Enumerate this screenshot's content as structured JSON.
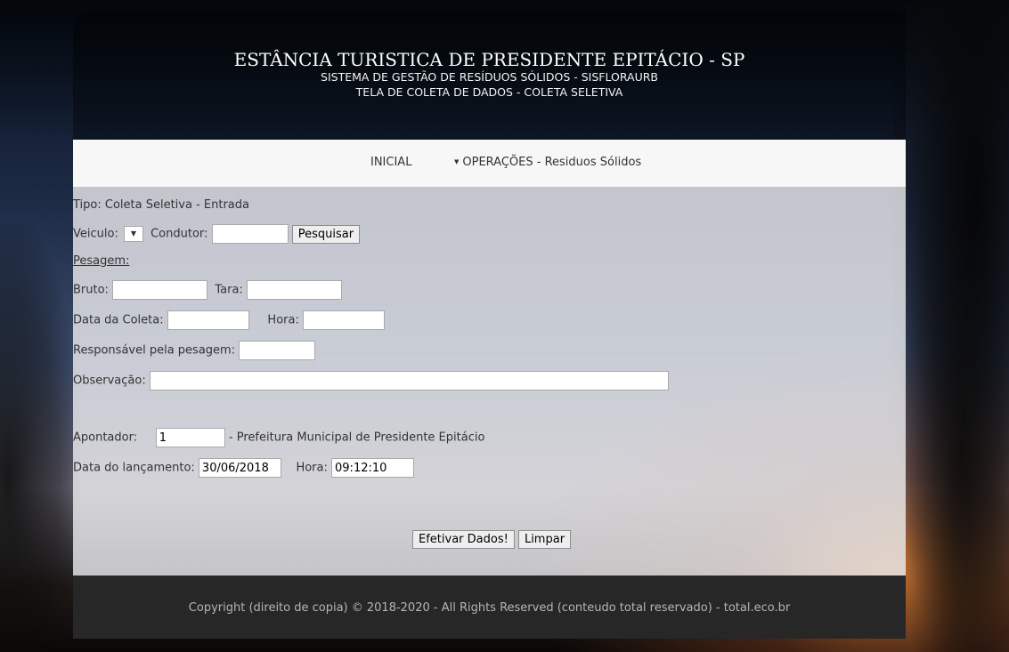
{
  "header": {
    "title": "ESTÂNCIA TURISTICA DE PRESIDENTE EPITÁCIO - SP",
    "subtitle1": "SISTEMA DE GESTÃO DE RESÍDUOS SÓLIDOS - SISFLORAURB",
    "subtitle2": "TELA DE COLETA DE DADOS - COLETA SELETIVA"
  },
  "nav": {
    "home": "INICIAL",
    "operations": "OPERAÇÕES - Residuos Sólidos"
  },
  "form": {
    "tipo": "Tipo: Coleta Seletiva - Entrada",
    "veiculo_label": "Veiculo:",
    "condutor_label": "Condutor:",
    "condutor_value": "",
    "pesquisar_label": "Pesquisar",
    "pesagem_label": "Pesagem:",
    "bruto_label": "Bruto:",
    "bruto_value": "",
    "tara_label": "Tara:",
    "tara_value": "",
    "data_coleta_label": "Data da Coleta:",
    "data_coleta_value": "",
    "hora_label": "Hora:",
    "hora_value": "",
    "responsavel_label": "Responsável pela pesagem:",
    "responsavel_value": "",
    "observacao_label": "Observação:",
    "observacao_value": "",
    "apontador_label": "Apontador:",
    "apontador_value": "1",
    "apontador_desc": "- Prefeitura Municipal de Presidente Epitácio",
    "data_lancamento_label": "Data do lançamento:",
    "data_lancamento_value": "30/06/2018",
    "hora_lancamento_label": "Hora:",
    "hora_lancamento_value": "09:12:10",
    "efetivar_label": "Efetivar Dados!",
    "limpar_label": "Limpar"
  },
  "footer": {
    "copyright": "Copyright (direito de copia) © 2018-2020 - All Rights Reserved (conteudo total reservado) - total.eco.br"
  }
}
